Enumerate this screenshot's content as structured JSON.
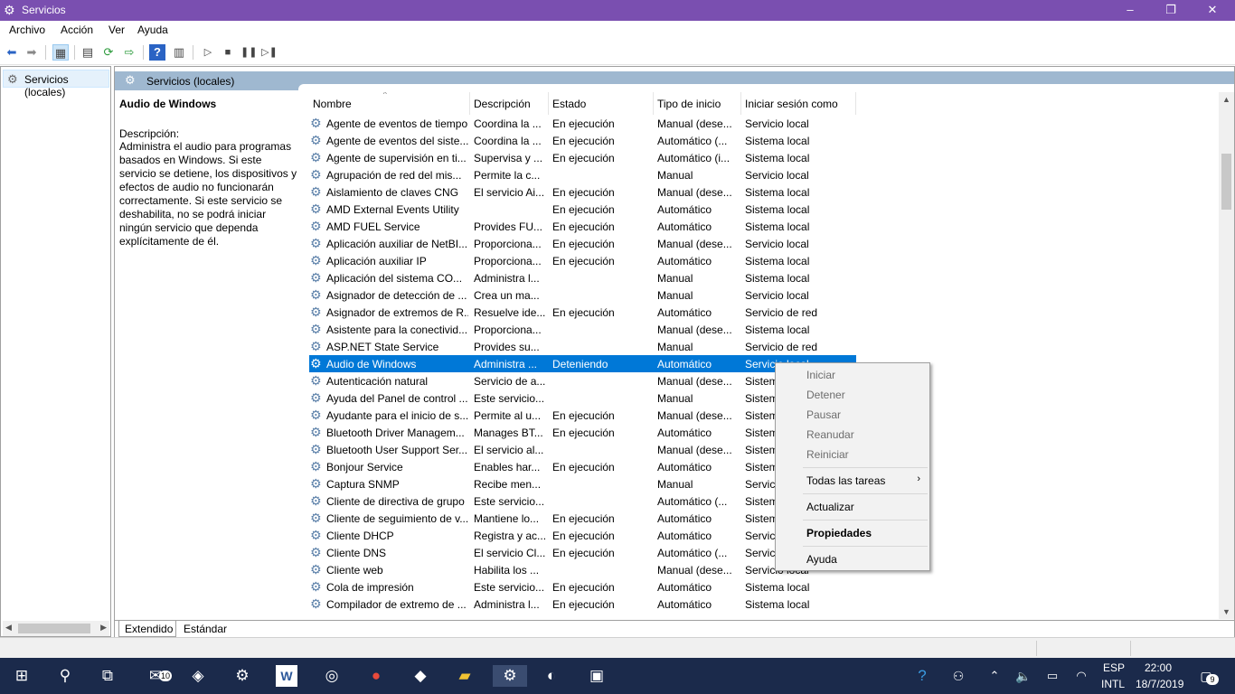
{
  "window": {
    "title": "Servicios",
    "buttons": {
      "minimize": "–",
      "maximize": "❐",
      "close": "✕"
    }
  },
  "menu": [
    "Archivo",
    "Acción",
    "Ver",
    "Ayuda"
  ],
  "left_tree": {
    "item": "Servicios (locales)"
  },
  "main": {
    "header": "Servicios (locales)",
    "selected_service": "Audio de Windows",
    "desc_label": "Descripción:",
    "desc_text": "Administra el audio para programas basados en Windows. Si este servicio se detiene, los dispositivos y efectos de audio no funcionarán correctamente. Si este servicio se deshabilita, no se podrá iniciar ningún servicio que dependa explícitamente de él.",
    "columns": [
      "Nombre",
      "Descripción",
      "Estado",
      "Tipo de inicio",
      "Iniciar sesión como"
    ],
    "rows": [
      [
        "Agente de eventos de tiempo",
        "Coordina la ...",
        "En ejecución",
        "Manual (dese...",
        "Servicio local"
      ],
      [
        "Agente de eventos del siste...",
        "Coordina la ...",
        "En ejecución",
        "Automático (...",
        "Sistema local"
      ],
      [
        "Agente de supervisión en ti...",
        "Supervisa y ...",
        "En ejecución",
        "Automático (i...",
        "Sistema local"
      ],
      [
        "Agrupación de red del mis...",
        "Permite la c...",
        "",
        "Manual",
        "Servicio local"
      ],
      [
        "Aislamiento de claves CNG",
        "El servicio Ai...",
        "En ejecución",
        "Manual (dese...",
        "Sistema local"
      ],
      [
        "AMD External Events Utility",
        "",
        "En ejecución",
        "Automático",
        "Sistema local"
      ],
      [
        "AMD FUEL Service",
        "Provides FU...",
        "En ejecución",
        "Automático",
        "Sistema local"
      ],
      [
        "Aplicación auxiliar de NetBI...",
        "Proporciona...",
        "En ejecución",
        "Manual (dese...",
        "Servicio local"
      ],
      [
        "Aplicación auxiliar IP",
        "Proporciona...",
        "En ejecución",
        "Automático",
        "Sistema local"
      ],
      [
        "Aplicación del sistema CO...",
        "Administra l...",
        "",
        "Manual",
        "Sistema local"
      ],
      [
        "Asignador de detección de ...",
        "Crea un ma...",
        "",
        "Manual",
        "Servicio local"
      ],
      [
        "Asignador de extremos de R...",
        "Resuelve ide...",
        "En ejecución",
        "Automático",
        "Servicio de red"
      ],
      [
        "Asistente para la conectivid...",
        "Proporciona...",
        "",
        "Manual (dese...",
        "Sistema local"
      ],
      [
        "ASP.NET State Service",
        "Provides su...",
        "",
        "Manual",
        "Servicio de red"
      ],
      [
        "Audio de Windows",
        "Administra ...",
        "Deteniendo",
        "Automático",
        "Servicio local"
      ],
      [
        "Autenticación natural",
        "Servicio de a...",
        "",
        "Manual (dese...",
        "Sistema local"
      ],
      [
        "Ayuda del Panel de control ...",
        "Este servicio...",
        "",
        "Manual",
        "Sistema local"
      ],
      [
        "Ayudante para el inicio de s...",
        "Permite al u...",
        "En ejecución",
        "Manual (dese...",
        "Sistema local"
      ],
      [
        "Bluetooth Driver Managem...",
        "Manages BT...",
        "En ejecución",
        "Automático",
        "Sistema local"
      ],
      [
        "Bluetooth User Support Ser...",
        "El servicio al...",
        "",
        "Manual (dese...",
        "Sistema local"
      ],
      [
        "Bonjour Service",
        "Enables har...",
        "En ejecución",
        "Automático",
        "Sistema local"
      ],
      [
        "Captura SNMP",
        "Recibe men...",
        "",
        "Manual",
        "Servicio local"
      ],
      [
        "Cliente de directiva de grupo",
        "Este servicio...",
        "",
        "Automático (...",
        "Sistema local"
      ],
      [
        "Cliente de seguimiento de v...",
        "Mantiene lo...",
        "En ejecución",
        "Automático",
        "Sistema local"
      ],
      [
        "Cliente DHCP",
        "Registra y ac...",
        "En ejecución",
        "Automático",
        "Servicio local"
      ],
      [
        "Cliente DNS",
        "El servicio Cl...",
        "En ejecución",
        "Automático (...",
        "Servicio de red"
      ],
      [
        "Cliente web",
        "Habilita los ...",
        "",
        "Manual (dese...",
        "Servicio local"
      ],
      [
        "Cola de impresión",
        "Este servicio...",
        "En ejecución",
        "Automático",
        "Sistema local"
      ],
      [
        "Compilador de extremo de ...",
        "Administra l...",
        "En ejecución",
        "Automático",
        "Sistema local"
      ]
    ],
    "selected_index": 14,
    "tabs": [
      "Extendido",
      "Estándar"
    ]
  },
  "context_menu": {
    "items": [
      "Iniciar",
      "Detener",
      "Pausar",
      "Reanudar",
      "Reiniciar",
      "Todas las tareas",
      "Actualizar",
      "Propiedades",
      "Ayuda"
    ]
  },
  "taskbar": {
    "mail_badge": "10",
    "lang_top": "ESP",
    "lang_bottom": "INTL",
    "time": "22:00",
    "date": "18/7/2019",
    "notif_count": "9"
  }
}
